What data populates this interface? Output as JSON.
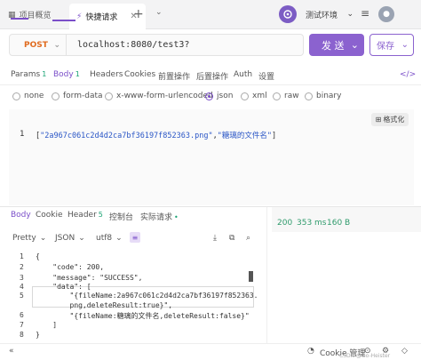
{
  "tabs": [
    {
      "label": "项目概览",
      "icon": "grid-icon"
    },
    {
      "label": "快捷请求",
      "icon": "lightning-icon",
      "active": true
    }
  ],
  "env": {
    "label": "测试环境"
  },
  "request": {
    "method": "POST",
    "url": "localhost:8080/test3?",
    "send_label": "发 送",
    "save_label": "保存"
  },
  "request_tabs": [
    {
      "label": "Params",
      "badge": "1"
    },
    {
      "label": "Body",
      "badge": "1",
      "active": true
    },
    {
      "label": "Headers",
      "badge": ""
    },
    {
      "label": "Cookies",
      "badge": ""
    },
    {
      "label": "前置操作",
      "badge": ""
    },
    {
      "label": "后置操作",
      "badge": ""
    },
    {
      "label": "Auth",
      "badge": ""
    },
    {
      "label": "设置",
      "badge": ""
    }
  ],
  "body_types": [
    "none",
    "form-data",
    "x-www-form-urlencoded",
    "json",
    "xml",
    "raw",
    "binary"
  ],
  "body_selected": "json",
  "format_label": "格式化",
  "request_body": {
    "line_no": "1",
    "text_open": "[",
    "str1": "\"2a967c061c2d4d2ca7bf36197f852363.png\"",
    "comma": ",",
    "str2": "\"糖璃的文件名\"",
    "text_close": "]"
  },
  "response_tabs": [
    {
      "label": "Body",
      "active": true
    },
    {
      "label": "Cookie"
    },
    {
      "label": "Header",
      "badge": "5"
    },
    {
      "label": "控制台"
    },
    {
      "label": "实际请求",
      "dot": "•"
    }
  ],
  "response_stats": {
    "status": "200",
    "time": "353 ms",
    "size": "160 B"
  },
  "response_toolbar": {
    "view": "Pretty",
    "format": "JSON",
    "encoding": "utf8"
  },
  "response_lines": [
    {
      "no": "1",
      "text": "{"
    },
    {
      "no": "2",
      "text": "    \"code\": 200,"
    },
    {
      "no": "3",
      "text": "    \"message\": \"SUCCESS\","
    },
    {
      "no": "4",
      "text": "    \"data\": ["
    },
    {
      "no": "5",
      "text": "        \"{fileName:2a967c061c2d4d2ca7bf36197f852363."
    },
    {
      "no": "",
      "text": "        png,deleteResult:true}\","
    },
    {
      "no": "6",
      "text": "        \"{fileName:糖璃的文件名,deleteResult:false}\""
    },
    {
      "no": "7",
      "text": "    ]"
    },
    {
      "no": "8",
      "text": "}"
    }
  ],
  "statusbar": {
    "cookie_label": "Cookie 管理"
  },
  "watermark": "CSDN @Go-Heister"
}
